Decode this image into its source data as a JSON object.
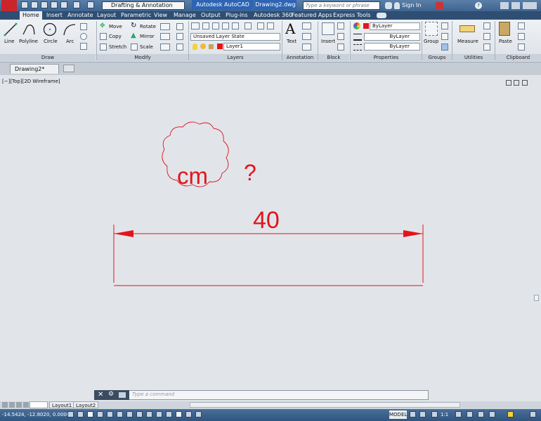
{
  "titlebar": {
    "workspace": "Drafting & Annotation",
    "app_name": "Autodesk AutoCAD 2014",
    "file_name": "Drawing2.dwg",
    "search_placeholder": "Type a keyword or phrase",
    "sign_in": "Sign In"
  },
  "ribbon_tabs": [
    "Home",
    "Insert",
    "Annotate",
    "Layout",
    "Parametric",
    "View",
    "Manage",
    "Output",
    "Plug-ins",
    "Autodesk 360",
    "Featured Apps",
    "Express Tools"
  ],
  "draw": {
    "title": "Draw",
    "line": "Line",
    "polyline": "Polyline",
    "circle": "Circle",
    "arc": "Arc"
  },
  "modify": {
    "title": "Modify",
    "move": "Move",
    "rotate": "Rotate",
    "copy": "Copy",
    "mirror": "Mirror",
    "stretch": "Stretch",
    "scale": "Scale"
  },
  "layers": {
    "title": "Layers",
    "layer_state": "Unsaved Layer State",
    "current_layer": "Layer1"
  },
  "annotation": {
    "title": "Annotation",
    "text": "Text"
  },
  "block": {
    "title": "Block",
    "insert": "Insert"
  },
  "properties": {
    "title": "Properties",
    "color": "ByLayer",
    "linetype": "ByLayer",
    "lineweight": "ByLayer"
  },
  "groups": {
    "title": "Groups",
    "group": "Group"
  },
  "utilities": {
    "title": "Utilities",
    "measure": "Measure"
  },
  "clipboard": {
    "title": "Clipboard",
    "paste": "Paste"
  },
  "doc_tab": "Drawing2*",
  "viewport_label": "[−][Top][2D Wireframe]",
  "drawing": {
    "dimension_value": "40",
    "cloud_text": "cm",
    "question": "?"
  },
  "command_placeholder": "Type a command",
  "layout_tabs": [
    "Layout1",
    "Layout2"
  ],
  "status": {
    "coordinates": "-14.5424, -12.8020, 0.0000",
    "model": "MODEL",
    "scale": "1:1"
  },
  "colors": {
    "accent_red": "#e3141b",
    "title_bar": "#3e6590",
    "layer_swatch": "#e3141b"
  }
}
